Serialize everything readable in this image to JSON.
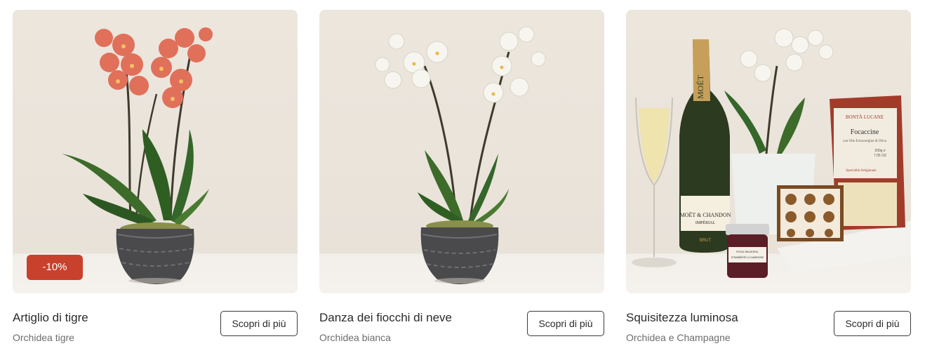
{
  "products": [
    {
      "title": "Artiglio di tigre",
      "subtitle": "Orchidea tigre",
      "cta_label": "Scopri di più",
      "discount_badge": "-10%",
      "image_icon": "tiger-orchid-photo",
      "flower_color": "#e0705a"
    },
    {
      "title": "Danza dei fiocchi di neve",
      "subtitle": "Orchidea bianca",
      "cta_label": "Scopri di più",
      "image_icon": "white-orchid-photo",
      "flower_color": "#f6f4ef"
    },
    {
      "title": "Squisitezza luminosa",
      "subtitle": "Orchidea e Champagne",
      "cta_label": "Scopri di più",
      "image_icon": "orchid-champagne-gift-photo",
      "flower_color": "#f6f4ef",
      "packaging_labels": {
        "bottle_neck": "MOËT",
        "bottle_label": "MOËT & CHANDON",
        "bottle_sub": "IMPÉRIAL",
        "bottle_brut": "BRUT",
        "snack_brand": "BONTÀ LUCANE",
        "snack_name": "Focaccine",
        "snack_desc": "con Olio Extravergine di Oliva",
        "snack_weight": "200g e",
        "snack_oz": "7.05 OZ",
        "snack_tag": "Specialità Artigianale",
        "jar_label": "ROYAL BALMORAL",
        "jar_sub": "STRAWBERRY & CHAMPAGNE"
      }
    }
  ]
}
